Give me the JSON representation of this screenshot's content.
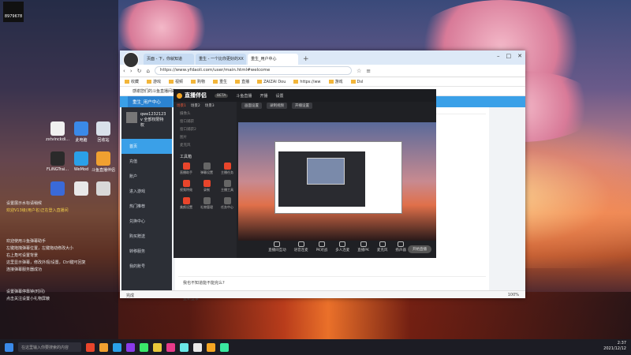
{
  "desktop": {
    "top_badge": "8979678",
    "icons": [
      {
        "label": "zxtvinckdi...",
        "color": "#f0f0f0"
      },
      {
        "label": "此电脑",
        "color": "#3a8ae8"
      },
      {
        "label": "回收站",
        "color": "#d8e0ea"
      },
      {
        "label": "FLiNGTrai...",
        "color": "#2a2a2a"
      },
      {
        "label": "WeMod",
        "color": "#2aa0e8"
      },
      {
        "label": "斗鱼直播伴侣",
        "color": "#f0a030"
      },
      {
        "label": "",
        "color": "#3a6ad8"
      },
      {
        "label": "",
        "color": "#e8e8e8"
      },
      {
        "label": "",
        "color": "#d8d8d8"
      }
    ],
    "side_lines_1": [
      "设置展示水标请稍候",
      "欢迎V13级(用户名)正在登入直播间"
    ],
    "side_lines_2": [
      "欢迎使用斗鱼弹幕助手",
      "左键拖拽弹幕位置，左键拖动修改大小",
      "右上角可设置背景",
      "这里显示弹幕，修改外观/设置，Ctrl键可回复",
      "连接弹幕服务器成功"
    ],
    "side_lines_3": [
      "设置弹幕停靠钟(时间)",
      "点击关注设置小礼物屏蔽"
    ]
  },
  "browser": {
    "tabs": [
      "页面 - 下，你就知道",
      "重生 - 一个比你更好的XX",
      "重生_用户中心"
    ],
    "url": "https://www.yfdaoli.com/user/main.html#welcome",
    "bookmarks": [
      "收藏",
      "游戏",
      "视频",
      "购物",
      "重生",
      "直播",
      "ZAIZAI Dou",
      "https://ww",
      "游戏",
      "Dsl"
    ],
    "notice": "感谢您们的斗鱼直播间的…",
    "user_center": "重生_用户中心",
    "profile_name": "qwe1232123",
    "profile_sub": "v 全部权限特权",
    "side_items": [
      "首页",
      "充值",
      "账户",
      "进入游戏",
      "热门推荐",
      "兑换中心",
      "购买赠送",
      "转移服务",
      "我的账号"
    ],
    "rows": [
      "优化推荐",
      "",
      "",
      "",
      "",
      "我也不知道能不能完么?",
      "重新登录"
    ],
    "status_left": "完成",
    "status_right": "100%"
  },
  "app": {
    "logo": "直播伴侣",
    "badge": "BETA",
    "head_items": [
      "斗鱼直播",
      "开播",
      "设置"
    ],
    "scene_tabs": [
      "场景1",
      "场景2",
      "场景3"
    ],
    "scene_rows": [
      "摄像头",
      "窗口捕获",
      "窗口捕获2",
      "图片",
      "麦克风"
    ],
    "tools_title": "工具箱",
    "tools": [
      "直播助手",
      "弹幕设置",
      "主播任务",
      "视频特效",
      "录制",
      "主播工具",
      "美颜设置",
      "礼物管理",
      "任务中心"
    ],
    "toolbar": [
      "画面设置",
      "录制视频",
      "开播设置"
    ],
    "bottom": [
      "直播间互动",
      "语音连麦",
      "PK对战",
      "多人连麦",
      "直播PK",
      "麦克风",
      "扬声器"
    ],
    "go_live": "开始直播"
  },
  "taskbar": {
    "search": "在这里输入你要搜索的内容",
    "icons": [
      "#3a8ae8",
      "#e8452b",
      "#f0a030",
      "#2aa0e8",
      "#8a3ae8",
      "#3ae86a",
      "#e8c83a",
      "#e83a8a",
      "#6ae8e8",
      "#e8e8e8",
      "#f5a623",
      "#3ae8a0"
    ],
    "time": "2:37",
    "date": "2021/12/12"
  }
}
